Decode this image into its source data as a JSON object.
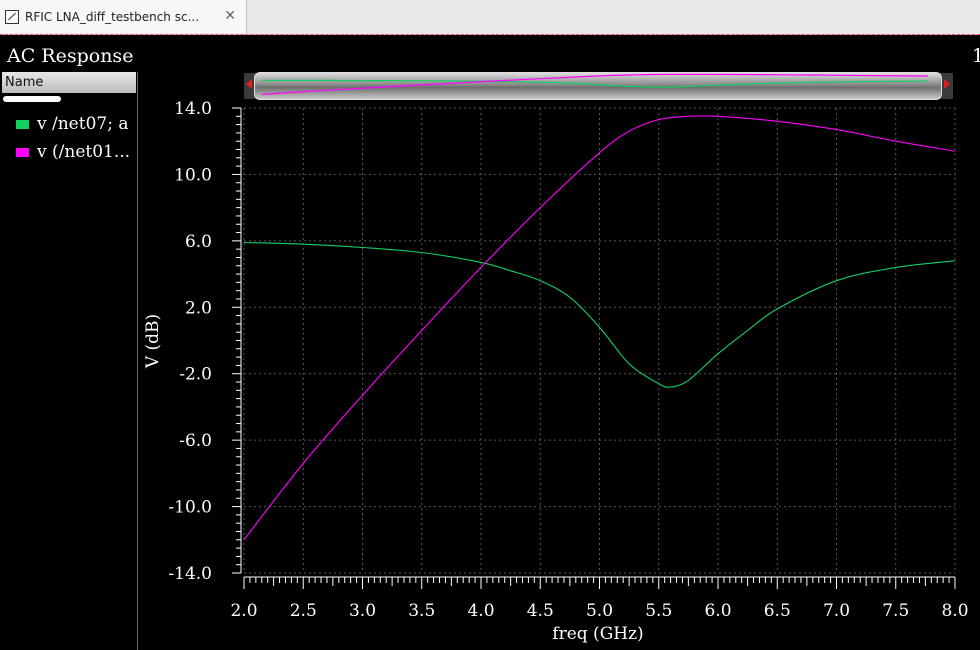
{
  "tab": {
    "title": "RFIC LNA_diff_testbench sc...",
    "close_glyph": "✕"
  },
  "panel": {
    "title": "AC Response",
    "page_indicator": "1"
  },
  "legend": {
    "header": "Name",
    "items": [
      {
        "label": "v /net07; a",
        "color": "#12d060"
      },
      {
        "label": "v (/net01...",
        "color": "#ff00ff"
      }
    ]
  },
  "chart_data": {
    "type": "line",
    "title": "",
    "xlabel": "freq (GHz)",
    "ylabel": "V (dB)",
    "xlim": [
      2.0,
      8.0
    ],
    "ylim": [
      -14.0,
      14.0
    ],
    "x_ticks": [
      2.0,
      2.5,
      3.0,
      3.5,
      4.0,
      4.5,
      5.0,
      5.5,
      6.0,
      6.5,
      7.0,
      7.5,
      8.0
    ],
    "x_tick_labels": [
      "2.0",
      "2.5",
      "3.0",
      "3.5",
      "4.0",
      "4.5",
      "5.0",
      "5.5",
      "6.0",
      "6.5",
      "7.0",
      "7.5",
      "8.0"
    ],
    "y_ticks": [
      -14.0,
      -10.0,
      -6.0,
      -2.0,
      2.0,
      6.0,
      10.0,
      14.0
    ],
    "y_tick_labels": [
      "-14.0",
      "-10.0",
      "-6.0",
      "-2.0",
      "2.0",
      "6.0",
      "10.0",
      "14.0"
    ],
    "grid": true,
    "background": "#000000",
    "series": [
      {
        "name": "v /net07; a",
        "color": "#12d060",
        "x": [
          2.0,
          2.5,
          3.0,
          3.5,
          4.0,
          4.25,
          4.5,
          4.75,
          5.0,
          5.25,
          5.5,
          5.6,
          5.75,
          6.0,
          6.25,
          6.5,
          7.0,
          7.5,
          8.0
        ],
        "y": [
          5.9,
          5.8,
          5.6,
          5.3,
          4.7,
          4.2,
          3.6,
          2.6,
          0.8,
          -1.4,
          -2.6,
          -2.8,
          -2.4,
          -0.8,
          0.6,
          1.9,
          3.6,
          4.4,
          4.8
        ]
      },
      {
        "name": "v (/net01...",
        "color": "#ff00ff",
        "x": [
          2.0,
          2.5,
          3.0,
          3.5,
          4.0,
          4.5,
          5.0,
          5.25,
          5.5,
          5.75,
          6.0,
          6.5,
          7.0,
          7.5,
          8.0
        ],
        "y": [
          -12.0,
          -7.4,
          -3.3,
          0.6,
          4.4,
          8.0,
          11.3,
          12.6,
          13.3,
          13.5,
          13.5,
          13.2,
          12.7,
          12.0,
          11.4
        ]
      }
    ]
  }
}
